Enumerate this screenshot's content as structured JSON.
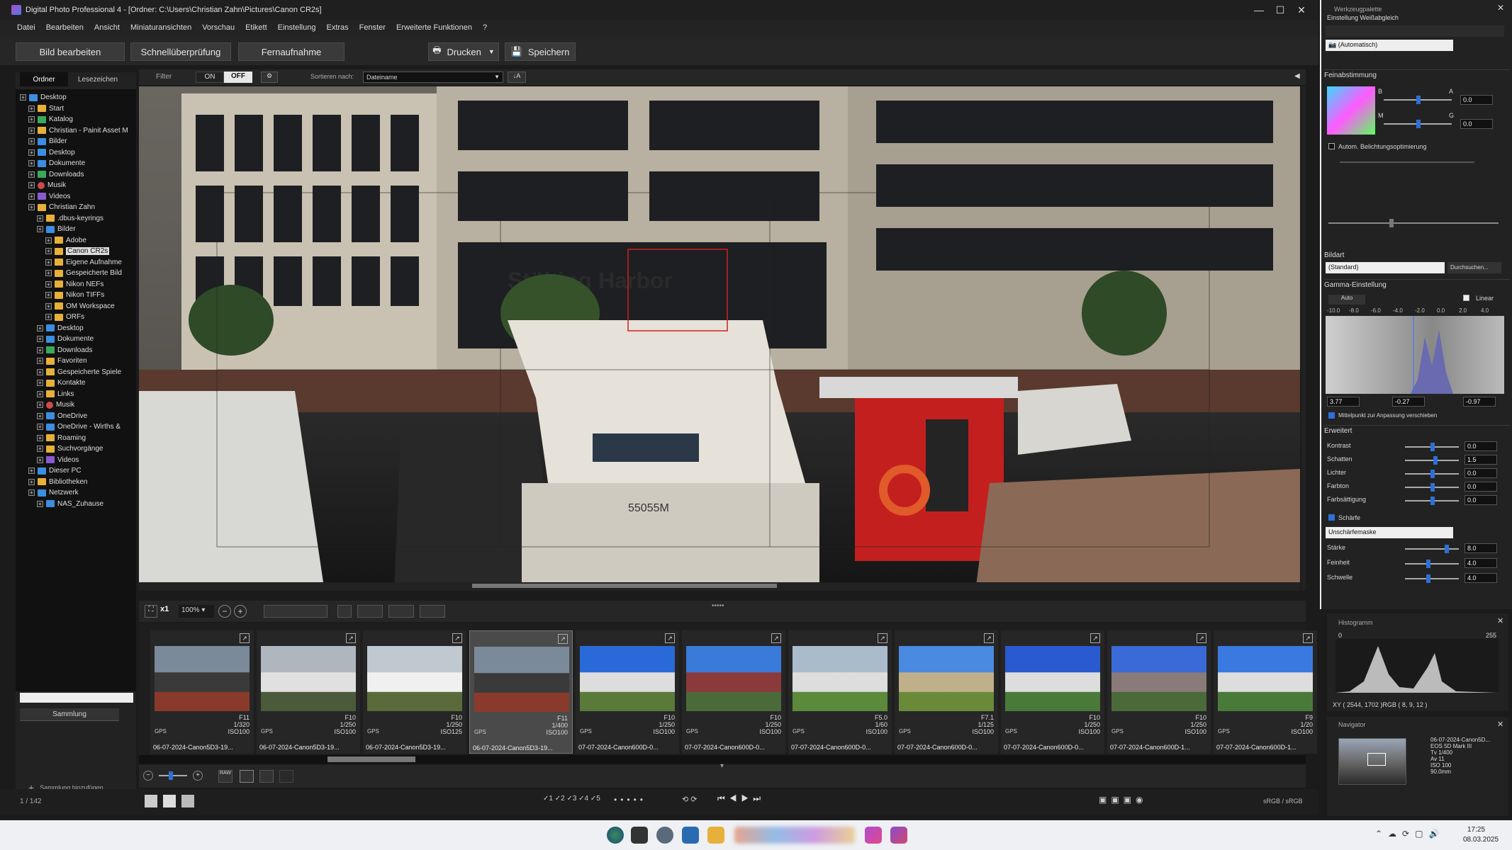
{
  "window": {
    "title": "Digital Photo Professional 4 - [Ordner: C:\\Users\\Christian Zahn\\Pictures\\Canon CR2s]"
  },
  "menu": [
    "Datei",
    "Bearbeiten",
    "Ansicht",
    "Miniaturansichten",
    "Vorschau",
    "Etikett",
    "Einstellung",
    "Extras",
    "Fenster",
    "Erweiterte Funktionen",
    "?"
  ],
  "toolbar": {
    "edit": "Bild bearbeiten",
    "quick": "Schnellüberprüfung",
    "remote": "Fernaufnahme",
    "print": "Drucken",
    "save": "Speichern"
  },
  "left": {
    "tab_folder": "Ordner",
    "tab_bookmarks": "Lesezeichen",
    "tree": [
      {
        "label": "Desktop",
        "lvl": 0,
        "icon": "blue"
      },
      {
        "label": "Start",
        "lvl": 1,
        "icon": "house"
      },
      {
        "label": "Katalog",
        "lvl": 1,
        "icon": "grn"
      },
      {
        "label": "Christian - Painit Asset M",
        "lvl": 1,
        "icon": "folder"
      },
      {
        "label": "Bilder",
        "lvl": 1,
        "icon": "blue"
      },
      {
        "label": "Desktop",
        "lvl": 1,
        "icon": "blue"
      },
      {
        "label": "Dokumente",
        "lvl": 1,
        "icon": "blue"
      },
      {
        "label": "Downloads",
        "lvl": 1,
        "icon": "grn"
      },
      {
        "label": "Musik",
        "lvl": 1,
        "icon": "red"
      },
      {
        "label": "Videos",
        "lvl": 1,
        "icon": "pur"
      },
      {
        "label": "Christian Zahn",
        "lvl": 1,
        "icon": "folder"
      },
      {
        "label": ".dbus-keyrings",
        "lvl": 2,
        "icon": "folder"
      },
      {
        "label": "Bilder",
        "lvl": 2,
        "icon": "blue"
      },
      {
        "label": "Adobe",
        "lvl": 3,
        "icon": "folder"
      },
      {
        "label": "Canon CR2s",
        "lvl": 3,
        "icon": "folder",
        "sel": true
      },
      {
        "label": "Eigene Aufnahme",
        "lvl": 3,
        "icon": "folder"
      },
      {
        "label": "Gespeicherte Bild",
        "lvl": 3,
        "icon": "folder"
      },
      {
        "label": "Nikon NEFs",
        "lvl": 3,
        "icon": "folder"
      },
      {
        "label": "Nikon TIFFs",
        "lvl": 3,
        "icon": "folder"
      },
      {
        "label": "OM Workspace",
        "lvl": 3,
        "icon": "folder"
      },
      {
        "label": "ORFs",
        "lvl": 3,
        "icon": "folder"
      },
      {
        "label": "Desktop",
        "lvl": 2,
        "icon": "blue"
      },
      {
        "label": "Dokumente",
        "lvl": 2,
        "icon": "blue"
      },
      {
        "label": "Downloads",
        "lvl": 2,
        "icon": "grn"
      },
      {
        "label": "Favoriten",
        "lvl": 2,
        "icon": "folder"
      },
      {
        "label": "Gespeicherte Spiele",
        "lvl": 2,
        "icon": "folder"
      },
      {
        "label": "Kontakte",
        "lvl": 2,
        "icon": "folder"
      },
      {
        "label": "Links",
        "lvl": 2,
        "icon": "folder"
      },
      {
        "label": "Musik",
        "lvl": 2,
        "icon": "red"
      },
      {
        "label": "OneDrive",
        "lvl": 2,
        "icon": "blue"
      },
      {
        "label": "OneDrive - Wirths &",
        "lvl": 2,
        "icon": "blue"
      },
      {
        "label": "Roaming",
        "lvl": 2,
        "icon": "folder"
      },
      {
        "label": "Suchvorgänge",
        "lvl": 2,
        "icon": "folder"
      },
      {
        "label": "Videos",
        "lvl": 2,
        "icon": "pur"
      },
      {
        "label": "Dieser PC",
        "lvl": 1,
        "icon": "blue"
      },
      {
        "label": "Bibliotheken",
        "lvl": 1,
        "icon": "folder"
      },
      {
        "label": "Netzwerk",
        "lvl": 1,
        "icon": "blue"
      },
      {
        "label": "NAS_Zuhause",
        "lvl": 2,
        "icon": "blue"
      }
    ],
    "collection": "Sammlung",
    "add_collection": "Sammlung hinzufügen",
    "count": "1 / 142"
  },
  "filter": {
    "label": "Filter",
    "on": "ON",
    "off": "OFF",
    "sort_label": "Sortieren nach:",
    "sort_value": "Dateiname"
  },
  "subtools": {
    "zoom_mult": "x1",
    "zoom": "100%"
  },
  "thumbs": [
    {
      "f": "F11",
      "t": "1/320",
      "iso": "ISO100",
      "name": "06-07-2024-Canon5D3-19...",
      "style": "a"
    },
    {
      "f": "F10",
      "t": "1/250",
      "iso": "ISO100",
      "name": "06-07-2024-Canon5D3-19...",
      "style": "b"
    },
    {
      "f": "F10",
      "t": "1/250",
      "iso": "ISO125",
      "name": "06-07-2024-Canon5D3-19...",
      "style": "c"
    },
    {
      "f": "F11",
      "t": "1/400",
      "iso": "ISO100",
      "name": "06-07-2024-Canon5D3-19...",
      "style": "a",
      "sel": true
    },
    {
      "f": "F10",
      "t": "1/250",
      "iso": "ISO100",
      "name": "07-07-2024-Canon600D-0...",
      "style": "d"
    },
    {
      "f": "F10",
      "t": "1/250",
      "iso": "ISO100",
      "name": "07-07-2024-Canon600D-0...",
      "style": "e"
    },
    {
      "f": "F5.0",
      "t": "1/60",
      "iso": "ISO100",
      "name": "07-07-2024-Canon600D-0...",
      "style": "f"
    },
    {
      "f": "F7.1",
      "t": "1/125",
      "iso": "ISO100",
      "name": "07-07-2024-Canon600D-0...",
      "style": "g"
    },
    {
      "f": "F10",
      "t": "1/250",
      "iso": "ISO100",
      "name": "07-07-2024-Canon600D-0...",
      "style": "h"
    },
    {
      "f": "F10",
      "t": "1/250",
      "iso": "ISO100",
      "name": "07-07-2024-Canon600D-1...",
      "style": "i"
    },
    {
      "f": "F9",
      "t": "1/20",
      "iso": "ISO100",
      "name": "07-07-2024-Canon600D-1...",
      "style": "j"
    }
  ],
  "gps": "GPS",
  "status": {
    "colorspace": "sRGB / sRGB"
  },
  "right": {
    "palette": "Werkzeugpalette",
    "wb_title": "Einstellung Weißabgleich",
    "wb_value": "(Automatisch)",
    "fine": "Feinabstimmung",
    "b": "B",
    "a": "A",
    "m": "M",
    "g": "G",
    "val_a": "0.0",
    "val_g": "0.0",
    "auto_opt": "Autom. Belichtungsoptimierung",
    "bildart": "Bildart",
    "bildart_value": "(Standard)",
    "browse": "Durchsuchen...",
    "gamma": "Gamma-Einstellung",
    "auto": "Auto",
    "linear": "Linear",
    "gamma_ticks": [
      "-10.0",
      "-8.0",
      "-6.0",
      "-4.0",
      "-2.0",
      "0.0",
      "2.0",
      "4.0"
    ],
    "gamma_vals": [
      "3.77",
      "-0.27",
      "-0.97"
    ],
    "midpoint": "Mittelpunkt zur Anpassung verschieben",
    "erweitert": "Erweitert",
    "adv": [
      {
        "l": "Kontrast",
        "v": "0.0"
      },
      {
        "l": "Schatten",
        "v": "1.5"
      },
      {
        "l": "Lichter",
        "v": "0.0"
      },
      {
        "l": "Farbton",
        "v": "0.0"
      },
      {
        "l": "Farbsättigung",
        "v": "0.0"
      }
    ],
    "sharp": "Schärfe",
    "sharp_mode": "Unschärfemaske",
    "sharp_rows": [
      {
        "l": "Stärke",
        "v": "8.0"
      },
      {
        "l": "Feinheit",
        "v": "4.0"
      },
      {
        "l": "Schwelle",
        "v": "4.0"
      }
    ]
  },
  "histogram": {
    "title": "Histogramm",
    "min": "0",
    "max": "255",
    "readout": "XY ( 2544, 1702 )RGB (  8,  9,  12 )"
  },
  "navigator": {
    "title": "Navigator",
    "info": [
      "06-07-2024-Canon5D...",
      "EOS 5D Mark III",
      "Tv 1/400",
      "Av 11",
      "ISO 100",
      "90.0mm"
    ]
  },
  "taskbar": {
    "time": "17:25",
    "date": "08.03.2025"
  },
  "preview": {
    "sign": "Stölting Harbor",
    "boat": "55055M"
  }
}
